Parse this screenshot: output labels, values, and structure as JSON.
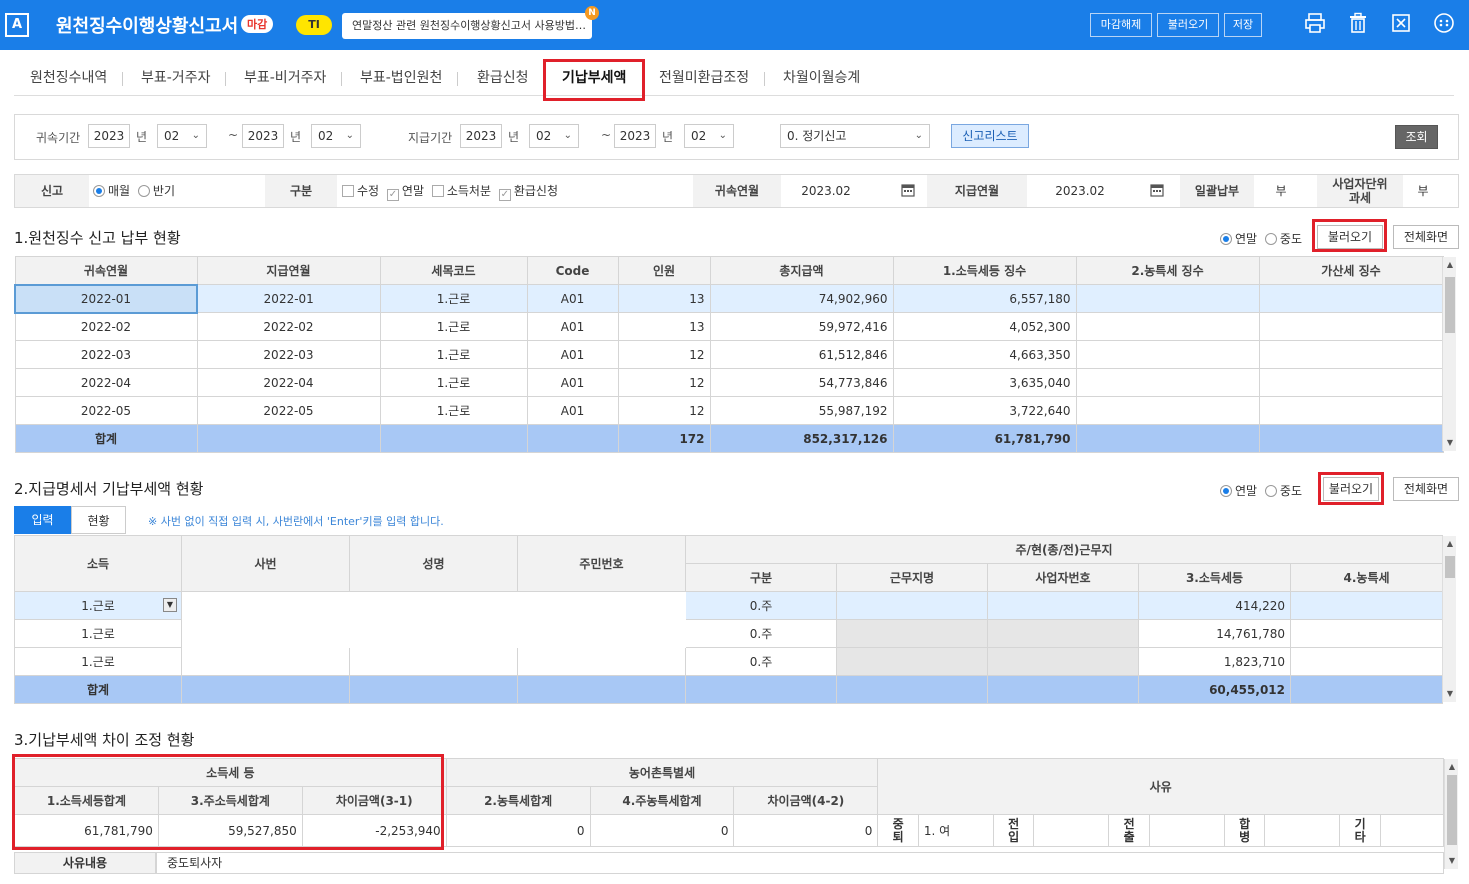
{
  "header": {
    "logo": "A",
    "title": "원천징수이행상황신고서",
    "closed_badge": "마감",
    "ti_badge": "TI",
    "notice": "연말정산 관련 원천징수이행상황신고서 사용방법…",
    "new_badge": "N",
    "btn_unclose": "마감해제",
    "btn_load": "불러오기",
    "btn_save": "저장",
    "icons": [
      "print-icon",
      "trash-icon",
      "excel-icon",
      "more-icon"
    ]
  },
  "tabs": [
    "원천징수내역",
    "부표-거주자",
    "부표-비거주자",
    "부표-법인원천",
    "환급신청",
    "기납부세액",
    "전월미환급조정",
    "차월이월승계"
  ],
  "filter": {
    "attr_period_label": "귀속기간",
    "y1": "2023",
    "m1": "02",
    "y2": "2023",
    "m2": "02",
    "year_unit": "년",
    "tilde": "~",
    "pay_period_label": "지급기간",
    "py1": "2023",
    "pm1": "02",
    "py2": "2023",
    "pm2": "02",
    "report_type": "0. 정기신고",
    "report_list_btn": "신고리스트",
    "search_btn": "조회"
  },
  "info": {
    "report_label": "신고",
    "monthly": "매월",
    "half": "반기",
    "type_label": "구분",
    "amend": "수정",
    "yearend": "연말",
    "income_disp": "소득처분",
    "refund_req": "환급신청",
    "attr_ym_label": "귀속연월",
    "attr_ym": "2023.02",
    "pay_ym_label": "지급연월",
    "pay_ym": "2023.02",
    "bulk_label": "일괄납부",
    "bulk_val": "부",
    "unit_label1": "사업자단위",
    "unit_label2": "과세",
    "unit_val": "부"
  },
  "sec1": {
    "title": "1.원천징수 신고 납부 현황",
    "r_yearend": "연말",
    "r_mid": "중도",
    "btn_load": "불러오기",
    "btn_full": "전체화면",
    "headers": [
      "귀속연월",
      "지급연월",
      "세목코드",
      "Code",
      "인원",
      "총지급액",
      "1.소득세등 징수",
      "2.농특세 징수",
      "가산세 징수"
    ],
    "rows": [
      [
        "2022-01",
        "2022-01",
        "1.근로",
        "A01",
        "13",
        "74,902,960",
        "6,557,180",
        "",
        ""
      ],
      [
        "2022-02",
        "2022-02",
        "1.근로",
        "A01",
        "13",
        "59,972,416",
        "4,052,300",
        "",
        ""
      ],
      [
        "2022-03",
        "2022-03",
        "1.근로",
        "A01",
        "12",
        "61,512,846",
        "4,663,350",
        "",
        ""
      ],
      [
        "2022-04",
        "2022-04",
        "1.근로",
        "A01",
        "12",
        "54,773,846",
        "3,635,040",
        "",
        ""
      ],
      [
        "2022-05",
        "2022-05",
        "1.근로",
        "A01",
        "12",
        "55,987,192",
        "3,722,640",
        "",
        ""
      ]
    ],
    "sum": [
      "합계",
      "",
      "",
      "",
      "172",
      "852,317,126",
      "61,781,790",
      "",
      ""
    ]
  },
  "sec2": {
    "title": "2.지급명세서 기납부세액 현황",
    "r_yearend": "연말",
    "r_mid": "중도",
    "btn_load": "불러오기",
    "btn_full": "전체화면",
    "tab_input": "입력",
    "tab_status": "현황",
    "hint": "※ 사번 없이 직접 입력 시, 사번란에서 'Enter'키를 입력 합니다.",
    "h_income": "소득",
    "h_empno": "사번",
    "h_name": "성명",
    "h_rrn": "주민번호",
    "h_work": "주/현(종/전)근무지",
    "h_div": "구분",
    "h_wp": "근무지명",
    "h_biz": "사업자번호",
    "h_inc": "3.소득세등",
    "h_agri": "4.농특세",
    "rows": [
      [
        "1.근로",
        "0.주",
        "414,220"
      ],
      [
        "1.근로",
        "0.주",
        "14,761,780"
      ],
      [
        "1.근로",
        "0.주",
        "1,823,710"
      ]
    ],
    "sum_label": "합계",
    "sum_inc": "60,455,012"
  },
  "sec3": {
    "title": "3.기납부세액 차이 조정 현황",
    "h_income_tax": "소득세 등",
    "h_agri_tax": "농어촌특별세",
    "h_reason": "사유",
    "h1": "1.소득세등합계",
    "h2": "3.주소득세합계",
    "h3": "차이금액(3-1)",
    "h4": "2.농특세합계",
    "h5": "4.주농특세합계",
    "h6": "차이금액(4-2)",
    "v1": "61,781,790",
    "v2": "59,527,850",
    "v3": "-2,253,940",
    "v4": "0",
    "v5": "0",
    "v6": "0",
    "r_mid": "중\n퇴",
    "r_mid_val": "1. 여",
    "r_in": "전\n입",
    "r_out": "전\n출",
    "r_merge": "합\n병",
    "r_etc": "기\n타",
    "reason_label": "사유내용",
    "reason_val": "중도퇴사자"
  }
}
